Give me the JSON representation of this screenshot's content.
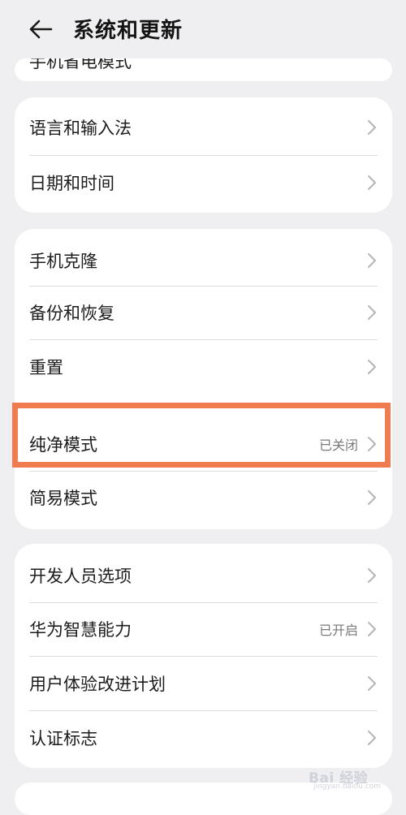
{
  "header": {
    "title": "系统和更新"
  },
  "top_card": {
    "partial_label": "手机省电模式"
  },
  "card1": {
    "items": [
      {
        "label": "语言和输入法"
      },
      {
        "label": "日期和时间"
      }
    ]
  },
  "card2": {
    "items": [
      {
        "label": "手机克隆"
      },
      {
        "label": "备份和恢复"
      },
      {
        "label": "重置"
      },
      {
        "label": "纯净模式",
        "status": "已关闭"
      },
      {
        "label": "简易模式"
      }
    ]
  },
  "card3": {
    "items": [
      {
        "label": "开发人员选项"
      },
      {
        "label": "华为智慧能力",
        "status": "已开启"
      },
      {
        "label": "用户体验改进计划"
      },
      {
        "label": "认证标志"
      }
    ]
  },
  "watermark": {
    "text": "Bai 经验",
    "sub": "jingyan.baidu.com"
  },
  "colors": {
    "background": "#efeff1",
    "card": "#ffffff",
    "highlight": "#f07b4e",
    "secondary_text": "#7a7a7a"
  }
}
